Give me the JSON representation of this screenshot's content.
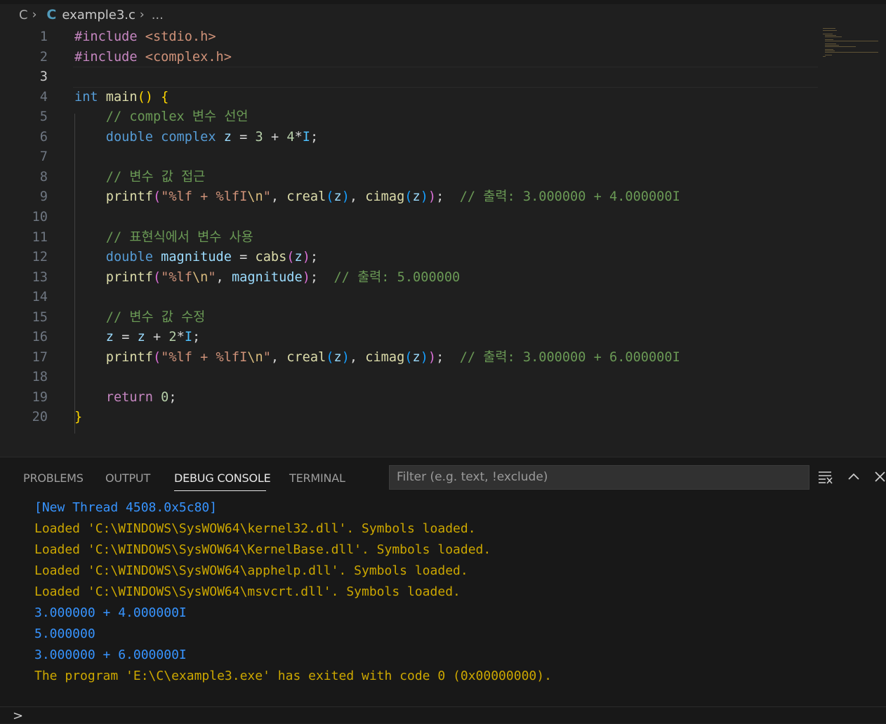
{
  "breadcrumb": {
    "folder": "C",
    "lang_icon": "C",
    "file": "example3.c",
    "more": "..."
  },
  "editor": {
    "lines": [
      {
        "n": "1",
        "html": "<span class='kw-pp'>#include</span> <span class='str'>&lt;stdio.h&gt;</span>"
      },
      {
        "n": "2",
        "html": "<span class='kw-pp'>#include</span> <span class='str'>&lt;complex.h&gt;</span>"
      },
      {
        "n": "3",
        "html": ""
      },
      {
        "n": "4",
        "html": "<span class='type'>int</span> <span class='fn'>main</span><span class='brace'>()</span> <span class='brace'>{</span>"
      },
      {
        "n": "5",
        "html": "    <span class='cmt'>// complex 변수 선언</span>"
      },
      {
        "n": "6",
        "html": "    <span class='type'>double</span> <span class='type'>complex</span> <span class='var'>z</span> <span class='plain'>=</span> <span class='num'>3</span> <span class='plain'>+</span> <span class='num'>4</span><span class='plain'>*</span><span class='cst'>I</span><span class='plain'>;</span>"
      },
      {
        "n": "7",
        "html": ""
      },
      {
        "n": "8",
        "html": "    <span class='cmt'>// 변수 값 접근</span>"
      },
      {
        "n": "9",
        "html": "    <span class='fn'>printf</span><span class='brace2'>(</span><span class='str'>\"%lf + %lfI</span><span class='esc'>\\n</span><span class='str'>\"</span><span class='plain'>,</span> <span class='fn'>creal</span><span class='brace3'>(</span><span class='var'>z</span><span class='brace3'>)</span><span class='plain'>,</span> <span class='fn'>cimag</span><span class='brace3'>(</span><span class='var'>z</span><span class='brace3'>)</span><span class='brace2'>)</span><span class='plain'>;</span>  <span class='cmt'>// 출력: 3.000000 + 4.000000I</span>"
      },
      {
        "n": "10",
        "html": ""
      },
      {
        "n": "11",
        "html": "    <span class='cmt'>// 표현식에서 변수 사용</span>"
      },
      {
        "n": "12",
        "html": "    <span class='type'>double</span> <span class='var'>magnitude</span> <span class='plain'>=</span> <span class='fn'>cabs</span><span class='brace2'>(</span><span class='var'>z</span><span class='brace2'>)</span><span class='plain'>;</span>"
      },
      {
        "n": "13",
        "html": "    <span class='fn'>printf</span><span class='brace2'>(</span><span class='str'>\"%lf</span><span class='esc'>\\n</span><span class='str'>\"</span><span class='plain'>,</span> <span class='var'>magnitude</span><span class='brace2'>)</span><span class='plain'>;</span>  <span class='cmt'>// 출력: 5.000000</span>"
      },
      {
        "n": "14",
        "html": ""
      },
      {
        "n": "15",
        "html": "    <span class='cmt'>// 변수 값 수정</span>"
      },
      {
        "n": "16",
        "html": "    <span class='var'>z</span> <span class='plain'>=</span> <span class='var'>z</span> <span class='plain'>+</span> <span class='num'>2</span><span class='plain'>*</span><span class='cst'>I</span><span class='plain'>;</span>"
      },
      {
        "n": "17",
        "html": "    <span class='fn'>printf</span><span class='brace2'>(</span><span class='str'>\"%lf + %lfI</span><span class='esc'>\\n</span><span class='str'>\"</span><span class='plain'>,</span> <span class='fn'>creal</span><span class='brace3'>(</span><span class='var'>z</span><span class='brace3'>)</span><span class='plain'>,</span> <span class='fn'>cimag</span><span class='brace3'>(</span><span class='var'>z</span><span class='brace3'>)</span><span class='brace2'>)</span><span class='plain'>;</span>  <span class='cmt'>// 출력: 3.000000 + 6.000000I</span>"
      },
      {
        "n": "18",
        "html": ""
      },
      {
        "n": "19",
        "html": "    <span class='ctl'>return</span> <span class='num'>0</span><span class='plain'>;</span>"
      },
      {
        "n": "20",
        "html": "<span class='brace'>}</span>"
      }
    ],
    "active_line": "3"
  },
  "panel": {
    "tabs": [
      "PROBLEMS",
      "OUTPUT",
      "DEBUG CONSOLE",
      "TERMINAL"
    ],
    "active_tab": "DEBUG CONSOLE",
    "filter_placeholder": "Filter (e.g. text, !exclude)",
    "console": [
      {
        "text": "[New Thread 4508.0x5c80]",
        "color": "blue"
      },
      {
        "text": "Loaded 'C:\\WINDOWS\\SysWOW64\\kernel32.dll'. Symbols loaded.",
        "color": "yellow"
      },
      {
        "text": "Loaded 'C:\\WINDOWS\\SysWOW64\\KernelBase.dll'. Symbols loaded.",
        "color": "yellow"
      },
      {
        "text": "Loaded 'C:\\WINDOWS\\SysWOW64\\apphelp.dll'. Symbols loaded.",
        "color": "yellow"
      },
      {
        "text": "Loaded 'C:\\WINDOWS\\SysWOW64\\msvcrt.dll'. Symbols loaded.",
        "color": "yellow"
      },
      {
        "text": "3.000000 + 4.000000I",
        "color": "blue"
      },
      {
        "text": "5.000000",
        "color": "blue"
      },
      {
        "text": "3.000000 + 6.000000I",
        "color": "blue"
      },
      {
        "text": "The program 'E:\\C\\example3.exe' has exited with code 0 (0x00000000).",
        "color": "yellow"
      }
    ],
    "prompt": ">"
  }
}
